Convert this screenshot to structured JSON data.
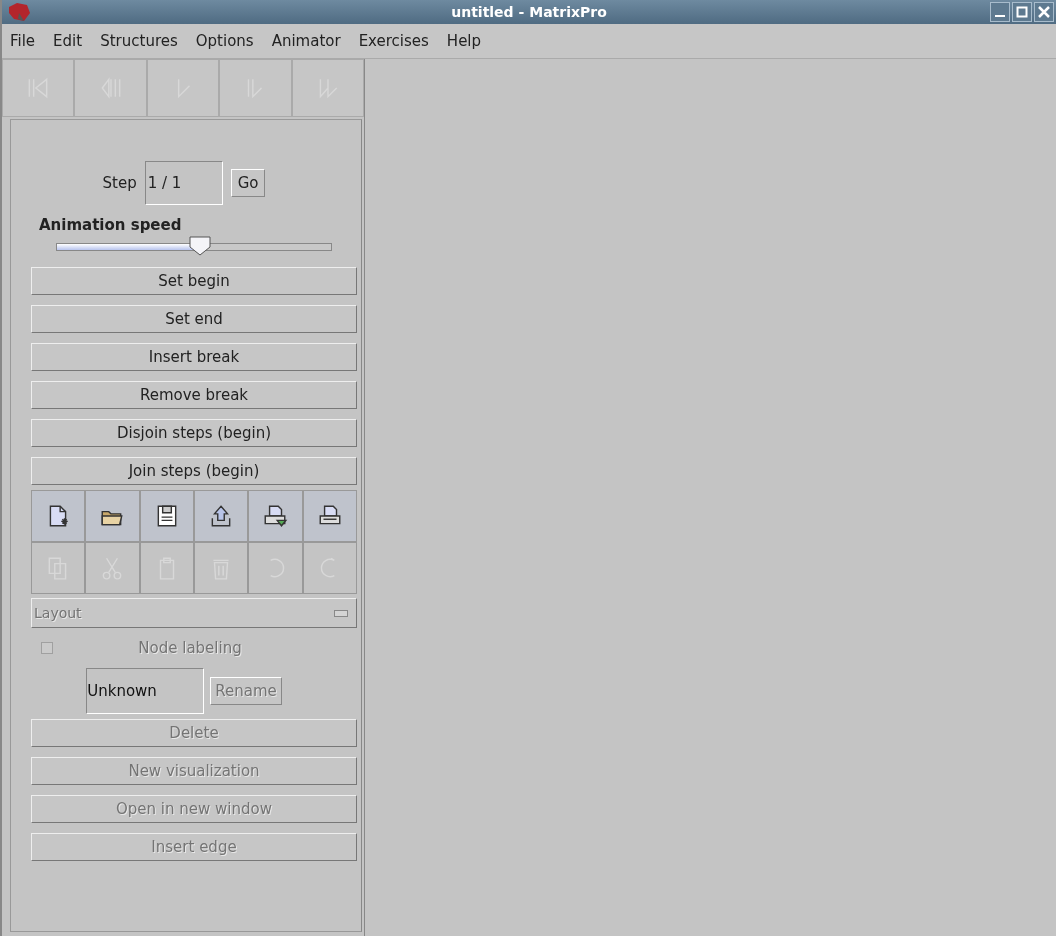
{
  "window": {
    "title": "untitled - MatrixPro"
  },
  "menus": [
    "File",
    "Edit",
    "Structures",
    "Options",
    "Animator",
    "Exercises",
    "Help"
  ],
  "player_controls": [
    {
      "kind": "first",
      "disabled": true
    },
    {
      "kind": "back",
      "disabled": true
    },
    {
      "kind": "play",
      "disabled": true
    },
    {
      "kind": "forward",
      "disabled": true
    },
    {
      "kind": "last",
      "disabled": true
    }
  ],
  "step": {
    "label": "Step",
    "value": "1 / 1",
    "button": "Go"
  },
  "speed": {
    "label": "Animation speed",
    "level": 0.52
  },
  "action_buttons": [
    {
      "label": "Set begin",
      "disabled": false
    },
    {
      "label": "Set end",
      "disabled": false
    },
    {
      "label": "Insert break",
      "disabled": false
    },
    {
      "label": "Remove break",
      "disabled": false
    },
    {
      "label": "Disjoin steps (begin)",
      "disabled": false
    },
    {
      "label": "Join steps (begin)",
      "disabled": false
    }
  ],
  "file_tools": [
    {
      "kind": "new",
      "disabled": false
    },
    {
      "kind": "open",
      "disabled": false
    },
    {
      "kind": "save",
      "disabled": false
    },
    {
      "kind": "upload",
      "disabled": false
    },
    {
      "kind": "print-preview",
      "disabled": false
    },
    {
      "kind": "print",
      "disabled": false
    }
  ],
  "edit_tools": [
    {
      "kind": "copy",
      "disabled": true
    },
    {
      "kind": "cut",
      "disabled": true
    },
    {
      "kind": "paste",
      "disabled": true
    },
    {
      "kind": "delete",
      "disabled": true
    },
    {
      "kind": "undo",
      "disabled": true
    },
    {
      "kind": "redo",
      "disabled": true
    }
  ],
  "layout": {
    "label": "Layout",
    "disabled": true
  },
  "node_labeling": {
    "label": "Node labeling",
    "checked": false,
    "disabled": true
  },
  "name_field": {
    "value": "Unknown"
  },
  "rename_button": {
    "label": "Rename",
    "disabled": true
  },
  "bottom_buttons": [
    {
      "label": "Delete",
      "disabled": true
    },
    {
      "label": "New visualization",
      "disabled": true
    },
    {
      "label": "Open in new window",
      "disabled": true
    },
    {
      "label": "Insert edge",
      "disabled": true
    }
  ]
}
